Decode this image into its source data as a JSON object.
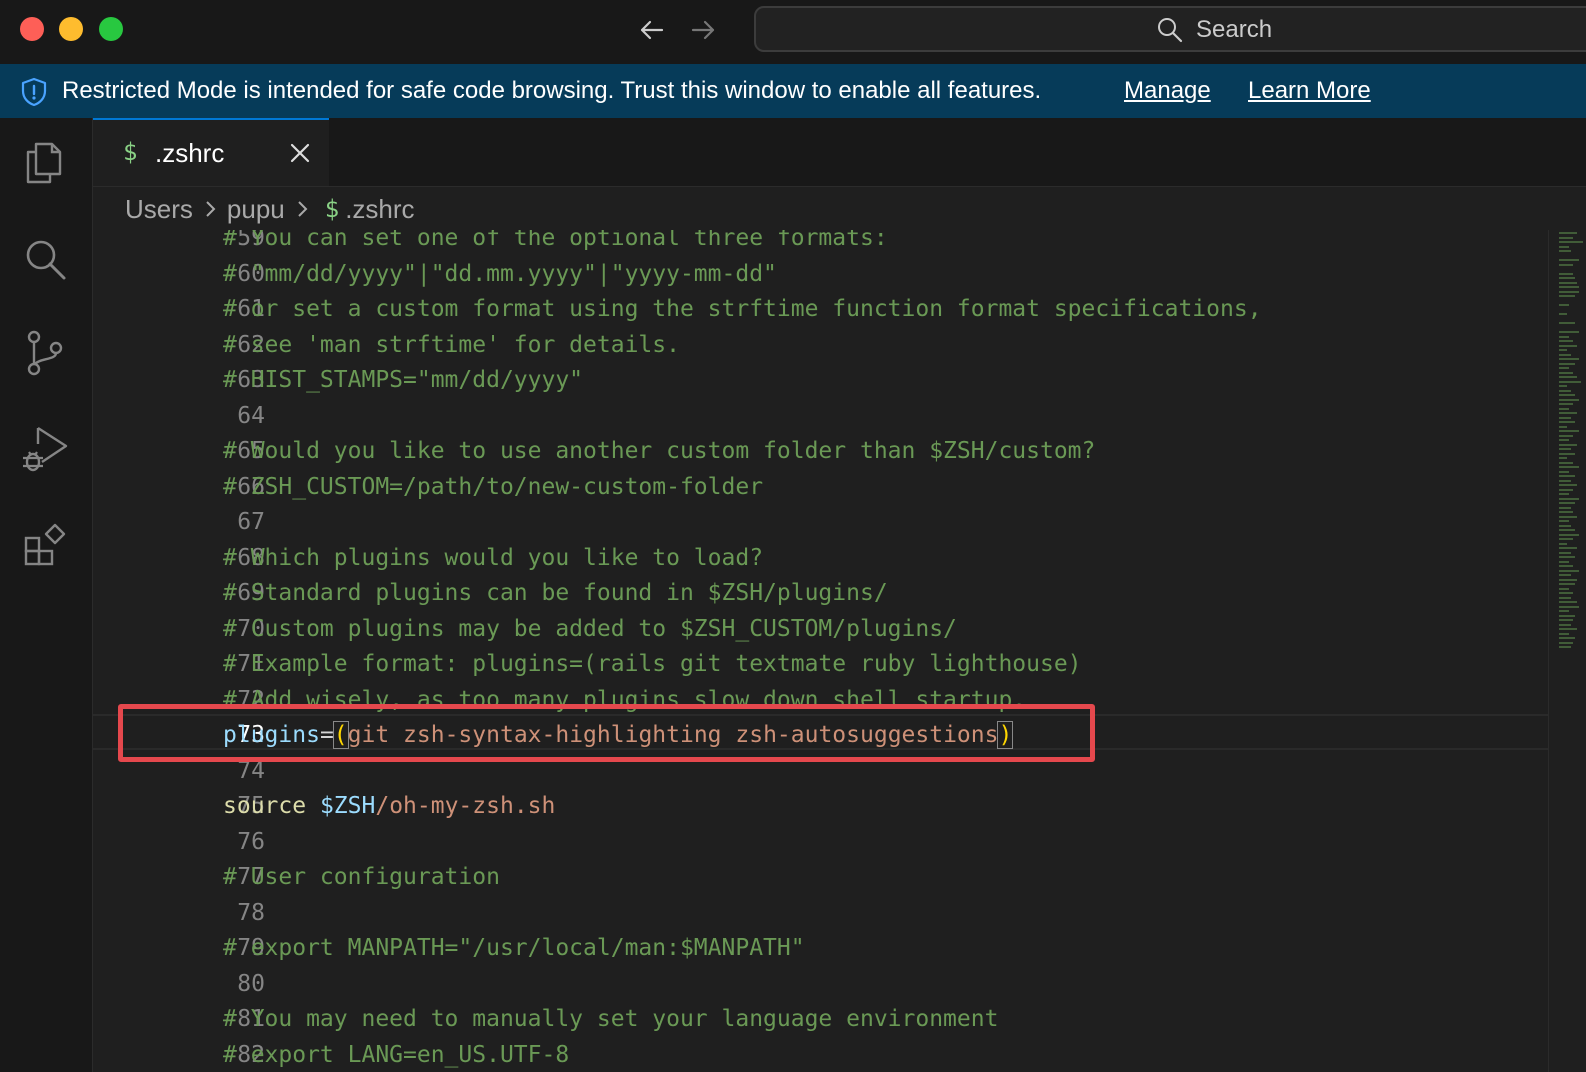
{
  "titlebar": {
    "back_icon": "arrow-left-icon",
    "forward_icon": "arrow-right-icon",
    "search_label": "Search"
  },
  "banner": {
    "message": "Restricted Mode is intended for safe code browsing. Trust this window to enable all features.",
    "manage_label": "Manage",
    "learn_more_label": "Learn More",
    "bg_color": "#063b59"
  },
  "activity_bar": {
    "icons": [
      "explorer-icon",
      "search-icon",
      "source-control-icon",
      "run-debug-icon",
      "extensions-icon"
    ]
  },
  "tab": {
    "icon": "$",
    "label": ".zshrc"
  },
  "breadcrumb": {
    "items": [
      "Users",
      "pupu",
      ".zshrc"
    ],
    "file_icon": "$"
  },
  "editor": {
    "active_line": "73",
    "lines": [
      {
        "n": "59",
        "text": "# You can set one of the optional three formats:"
      },
      {
        "n": "60",
        "text": "# \"mm/dd/yyyy\"|\"dd.mm.yyyy\"|\"yyyy-mm-dd\""
      },
      {
        "n": "61",
        "text": "# or set a custom format using the strftime function format specifications,"
      },
      {
        "n": "62",
        "text": "# see 'man strftime' for details."
      },
      {
        "n": "63",
        "text": "# HIST_STAMPS=\"mm/dd/yyyy\""
      },
      {
        "n": "64",
        "text": ""
      },
      {
        "n": "65",
        "text": "# Would you like to use another custom folder than $ZSH/custom?"
      },
      {
        "n": "66",
        "text": "# ZSH_CUSTOM=/path/to/new-custom-folder"
      },
      {
        "n": "67",
        "text": ""
      },
      {
        "n": "68",
        "text": "# Which plugins would you like to load?"
      },
      {
        "n": "69",
        "text": "# Standard plugins can be found in $ZSH/plugins/"
      },
      {
        "n": "70",
        "text": "# Custom plugins may be added to $ZSH_CUSTOM/plugins/"
      },
      {
        "n": "71",
        "text": "# Example format: plugins=(rails git textmate ruby lighthouse)"
      },
      {
        "n": "72",
        "text": "# Add wisely, as too many plugins slow down shell startup."
      },
      {
        "n": "73",
        "plugins_var": "plugins",
        "plugins_eq": "=",
        "plugins_open": "(",
        "plugins_body": "git zsh-syntax-highlighting zsh-autosuggestions",
        "plugins_close": ")"
      },
      {
        "n": "74",
        "text": ""
      },
      {
        "n": "75",
        "source_kw": "source",
        "source_var": "$ZSH",
        "source_path": "/oh-my-zsh.sh"
      },
      {
        "n": "76",
        "text": ""
      },
      {
        "n": "77",
        "text": "# User configuration"
      },
      {
        "n": "78",
        "text": ""
      },
      {
        "n": "79",
        "text": "# export MANPATH=\"/usr/local/man:$MANPATH\""
      },
      {
        "n": "80",
        "text": ""
      },
      {
        "n": "81",
        "text": "# You may need to manually set your language environment"
      },
      {
        "n": "82",
        "text": "# export LANG=en_US.UTF-8"
      }
    ]
  },
  "colors": {
    "comment": "#6a9955",
    "variable": "#9cdcfe",
    "string": "#ce9178",
    "function": "#dcdcaa",
    "bracket": "#ffd700",
    "highlight_box": "#e5484d",
    "tab_accent": "#0078d4"
  }
}
